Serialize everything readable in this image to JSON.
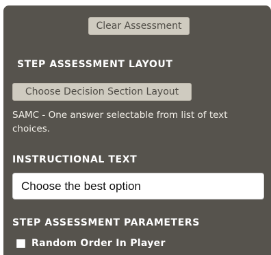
{
  "actions": {
    "clear_assessment_label": "Clear Assessment"
  },
  "step_assessment_layout": {
    "heading": "STEP ASSESSMENT LAYOUT",
    "choose_layout_label": "Choose Decision Section Layout",
    "description": "SAMC - One answer selectable from list of text choices."
  },
  "instructional_text": {
    "heading": "INSTRUCTIONAL TEXT",
    "value": "Choose the best option"
  },
  "step_assessment_parameters": {
    "heading": "STEP ASSESSMENT PARAMETERS",
    "random_order": {
      "label": "Random Order In Player",
      "checked": false
    }
  },
  "colors": {
    "panel_background": "#56534d",
    "button_background": "#cfcbc0",
    "heading_text": "#ffffff"
  }
}
